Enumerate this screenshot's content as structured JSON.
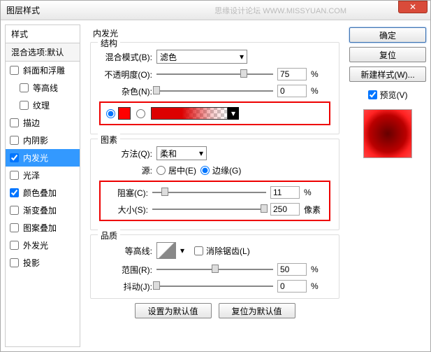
{
  "window": {
    "title": "图层样式"
  },
  "watermark": "思缘设计论坛   WWW.MISSYUAN.COM",
  "buttons": {
    "ok": "确定",
    "cancel": "复位",
    "newstyle": "新建样式(W)...",
    "preview": "预览(V)",
    "defaults_set": "设置为默认值",
    "defaults_reset": "复位为默认值"
  },
  "sidebar": {
    "header": "样式",
    "subheader": "混合选项:默认",
    "items": [
      {
        "label": "斜面和浮雕",
        "checked": false,
        "indent": false
      },
      {
        "label": "等高线",
        "checked": false,
        "indent": true
      },
      {
        "label": "纹理",
        "checked": false,
        "indent": true
      },
      {
        "label": "描边",
        "checked": false,
        "indent": false
      },
      {
        "label": "内阴影",
        "checked": false,
        "indent": false
      },
      {
        "label": "内发光",
        "checked": true,
        "indent": false,
        "selected": true
      },
      {
        "label": "光泽",
        "checked": false,
        "indent": false
      },
      {
        "label": "颜色叠加",
        "checked": true,
        "indent": false
      },
      {
        "label": "渐变叠加",
        "checked": false,
        "indent": false
      },
      {
        "label": "图案叠加",
        "checked": false,
        "indent": false
      },
      {
        "label": "外发光",
        "checked": false,
        "indent": false
      },
      {
        "label": "投影",
        "checked": false,
        "indent": false
      }
    ]
  },
  "panel": {
    "title": "内发光",
    "structure": {
      "title": "结构",
      "blend_label": "混合模式(B):",
      "blend_value": "滤色",
      "opacity_label": "不透明度(O):",
      "opacity_value": "75",
      "opacity_unit": "%",
      "noise_label": "杂色(N):",
      "noise_value": "0",
      "noise_unit": "%"
    },
    "elements": {
      "title": "图素",
      "method_label": "方法(Q):",
      "method_value": "柔和",
      "source_label": "源:",
      "source_center": "居中(E)",
      "source_edge": "边缘(G)",
      "choke_label": "阻塞(C):",
      "choke_value": "11",
      "choke_unit": "%",
      "size_label": "大小(S):",
      "size_value": "250",
      "size_unit": "像素"
    },
    "quality": {
      "title": "品质",
      "contour_label": "等高线:",
      "aa_label": "消除锯齿(L)",
      "range_label": "范围(R):",
      "range_value": "50",
      "range_unit": "%",
      "jitter_label": "抖动(J):",
      "jitter_value": "0",
      "jitter_unit": "%"
    }
  }
}
